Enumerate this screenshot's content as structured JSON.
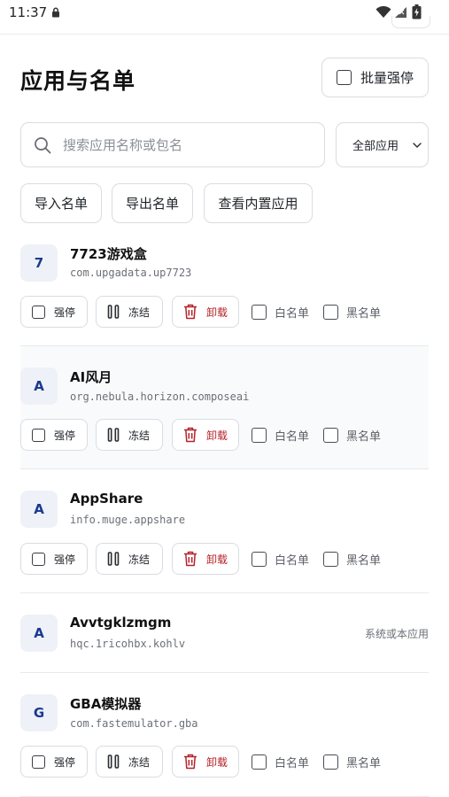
{
  "status_bar": {
    "time": "11:37"
  },
  "header": {
    "title": "应用与名单",
    "batch_label": "批量强停"
  },
  "search": {
    "placeholder": "搜索应用名称或包名",
    "filter_value": "全部应用"
  },
  "actions": {
    "import_label": "导入名单",
    "export_label": "导出名单",
    "builtin_label": "查看内置应用"
  },
  "labels": {
    "force_stop": "强停",
    "freeze": "冻结",
    "uninstall": "卸载",
    "whitelist": "白名单",
    "blacklist": "黑名单"
  },
  "apps": [
    {
      "initial": "7",
      "name": "7723游戏盒",
      "package": "com.upgadata.up7723"
    },
    {
      "initial": "A",
      "name": "AI风月",
      "package": "org.nebula.horizon.composeai"
    },
    {
      "initial": "A",
      "name": "AppShare",
      "package": "info.muge.appshare"
    },
    {
      "initial": "A",
      "name": "Avvtgklzmgm",
      "package": "hqc.1ricohbx.kohlv",
      "note": "系统或本应用"
    },
    {
      "initial": "G",
      "name": "GBA模拟器",
      "package": "com.fastemulator.gba"
    }
  ],
  "colors": {
    "accent": "#1a3a8f",
    "danger": "#b4232a",
    "border": "#d9dce1"
  }
}
